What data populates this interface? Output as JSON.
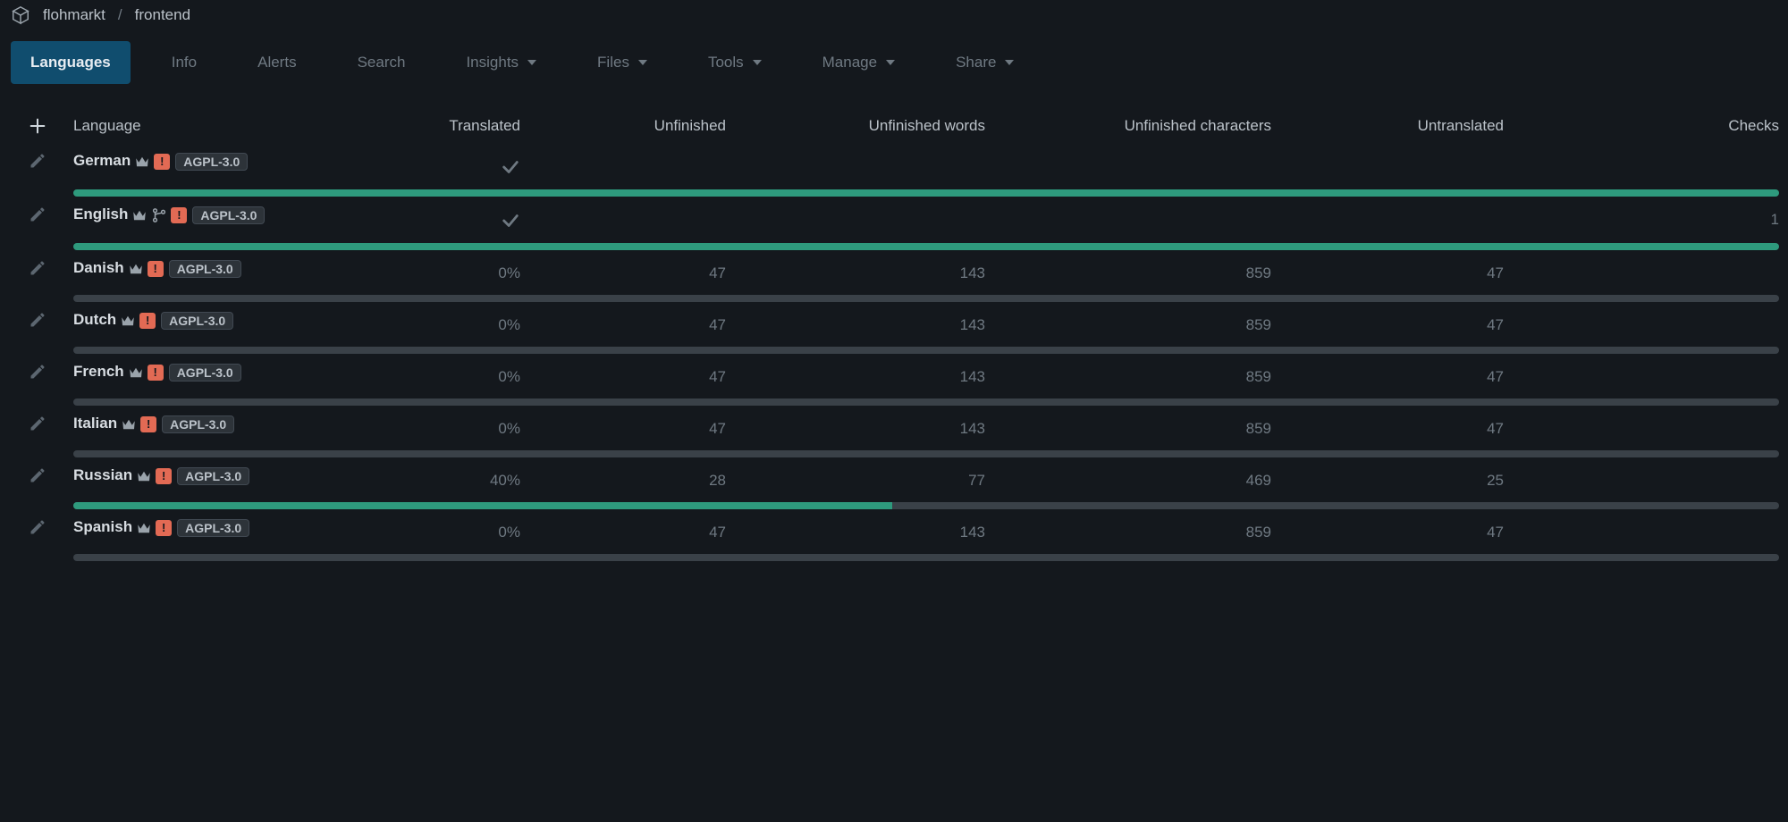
{
  "breadcrumb": {
    "project": "flohmarkt",
    "component": "frontend"
  },
  "tabs": [
    {
      "label": "Languages",
      "active": true,
      "caret": false
    },
    {
      "label": "Info",
      "active": false,
      "caret": false
    },
    {
      "label": "Alerts",
      "active": false,
      "caret": false
    },
    {
      "label": "Search",
      "active": false,
      "caret": false
    },
    {
      "label": "Insights",
      "active": false,
      "caret": true
    },
    {
      "label": "Files",
      "active": false,
      "caret": true
    },
    {
      "label": "Tools",
      "active": false,
      "caret": true
    },
    {
      "label": "Manage",
      "active": false,
      "caret": true
    },
    {
      "label": "Share",
      "active": false,
      "caret": true
    }
  ],
  "columns": {
    "language": "Language",
    "translated": "Translated",
    "unfinished": "Unfinished",
    "unfinished_words": "Unfinished words",
    "unfinished_chars": "Unfinished characters",
    "untranslated": "Untranslated",
    "checks": "Checks"
  },
  "license_label": "AGPL-3.0",
  "warn_glyph": "!",
  "rows": [
    {
      "name": "German",
      "source": false,
      "translated": "check",
      "unfinished": "",
      "unfinished_words": "",
      "unfinished_chars": "",
      "untranslated": "",
      "checks": "",
      "progress": 100
    },
    {
      "name": "English",
      "source": true,
      "translated": "check",
      "unfinished": "",
      "unfinished_words": "",
      "unfinished_chars": "",
      "untranslated": "",
      "checks": "1",
      "progress": 100
    },
    {
      "name": "Danish",
      "source": false,
      "translated": "0%",
      "unfinished": "47",
      "unfinished_words": "143",
      "unfinished_chars": "859",
      "untranslated": "47",
      "checks": "",
      "progress": 0
    },
    {
      "name": "Dutch",
      "source": false,
      "translated": "0%",
      "unfinished": "47",
      "unfinished_words": "143",
      "unfinished_chars": "859",
      "untranslated": "47",
      "checks": "",
      "progress": 0
    },
    {
      "name": "French",
      "source": false,
      "translated": "0%",
      "unfinished": "47",
      "unfinished_words": "143",
      "unfinished_chars": "859",
      "untranslated": "47",
      "checks": "",
      "progress": 0
    },
    {
      "name": "Italian",
      "source": false,
      "translated": "0%",
      "unfinished": "47",
      "unfinished_words": "143",
      "unfinished_chars": "859",
      "untranslated": "47",
      "checks": "",
      "progress": 0
    },
    {
      "name": "Russian",
      "source": false,
      "translated": "40%",
      "unfinished": "28",
      "unfinished_words": "77",
      "unfinished_chars": "469",
      "untranslated": "25",
      "checks": "",
      "progress": 48
    },
    {
      "name": "Spanish",
      "source": false,
      "translated": "0%",
      "unfinished": "47",
      "unfinished_words": "143",
      "unfinished_chars": "859",
      "untranslated": "47",
      "checks": "",
      "progress": 0
    }
  ]
}
